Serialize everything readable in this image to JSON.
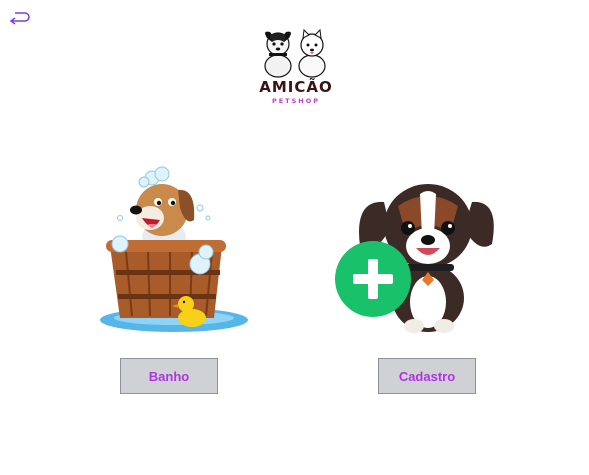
{
  "header": {
    "back_icon": "return-arrow-icon",
    "logo": {
      "title": "AMICÃO",
      "subtitle": "PETSHOP",
      "icon": "two-dogs-logo"
    }
  },
  "cards": [
    {
      "illustration": "dog-in-bathtub-illustration",
      "button_label": "Banho"
    },
    {
      "illustration": "puppy-with-plus-illustration",
      "button_label": "Cadastro",
      "badge_icon": "plus-icon"
    }
  ],
  "colors": {
    "button_text": "#b233e6",
    "button_bg": "#cfd1d5",
    "plus_badge": "#19c16a",
    "logo_text": "#3a1414"
  }
}
